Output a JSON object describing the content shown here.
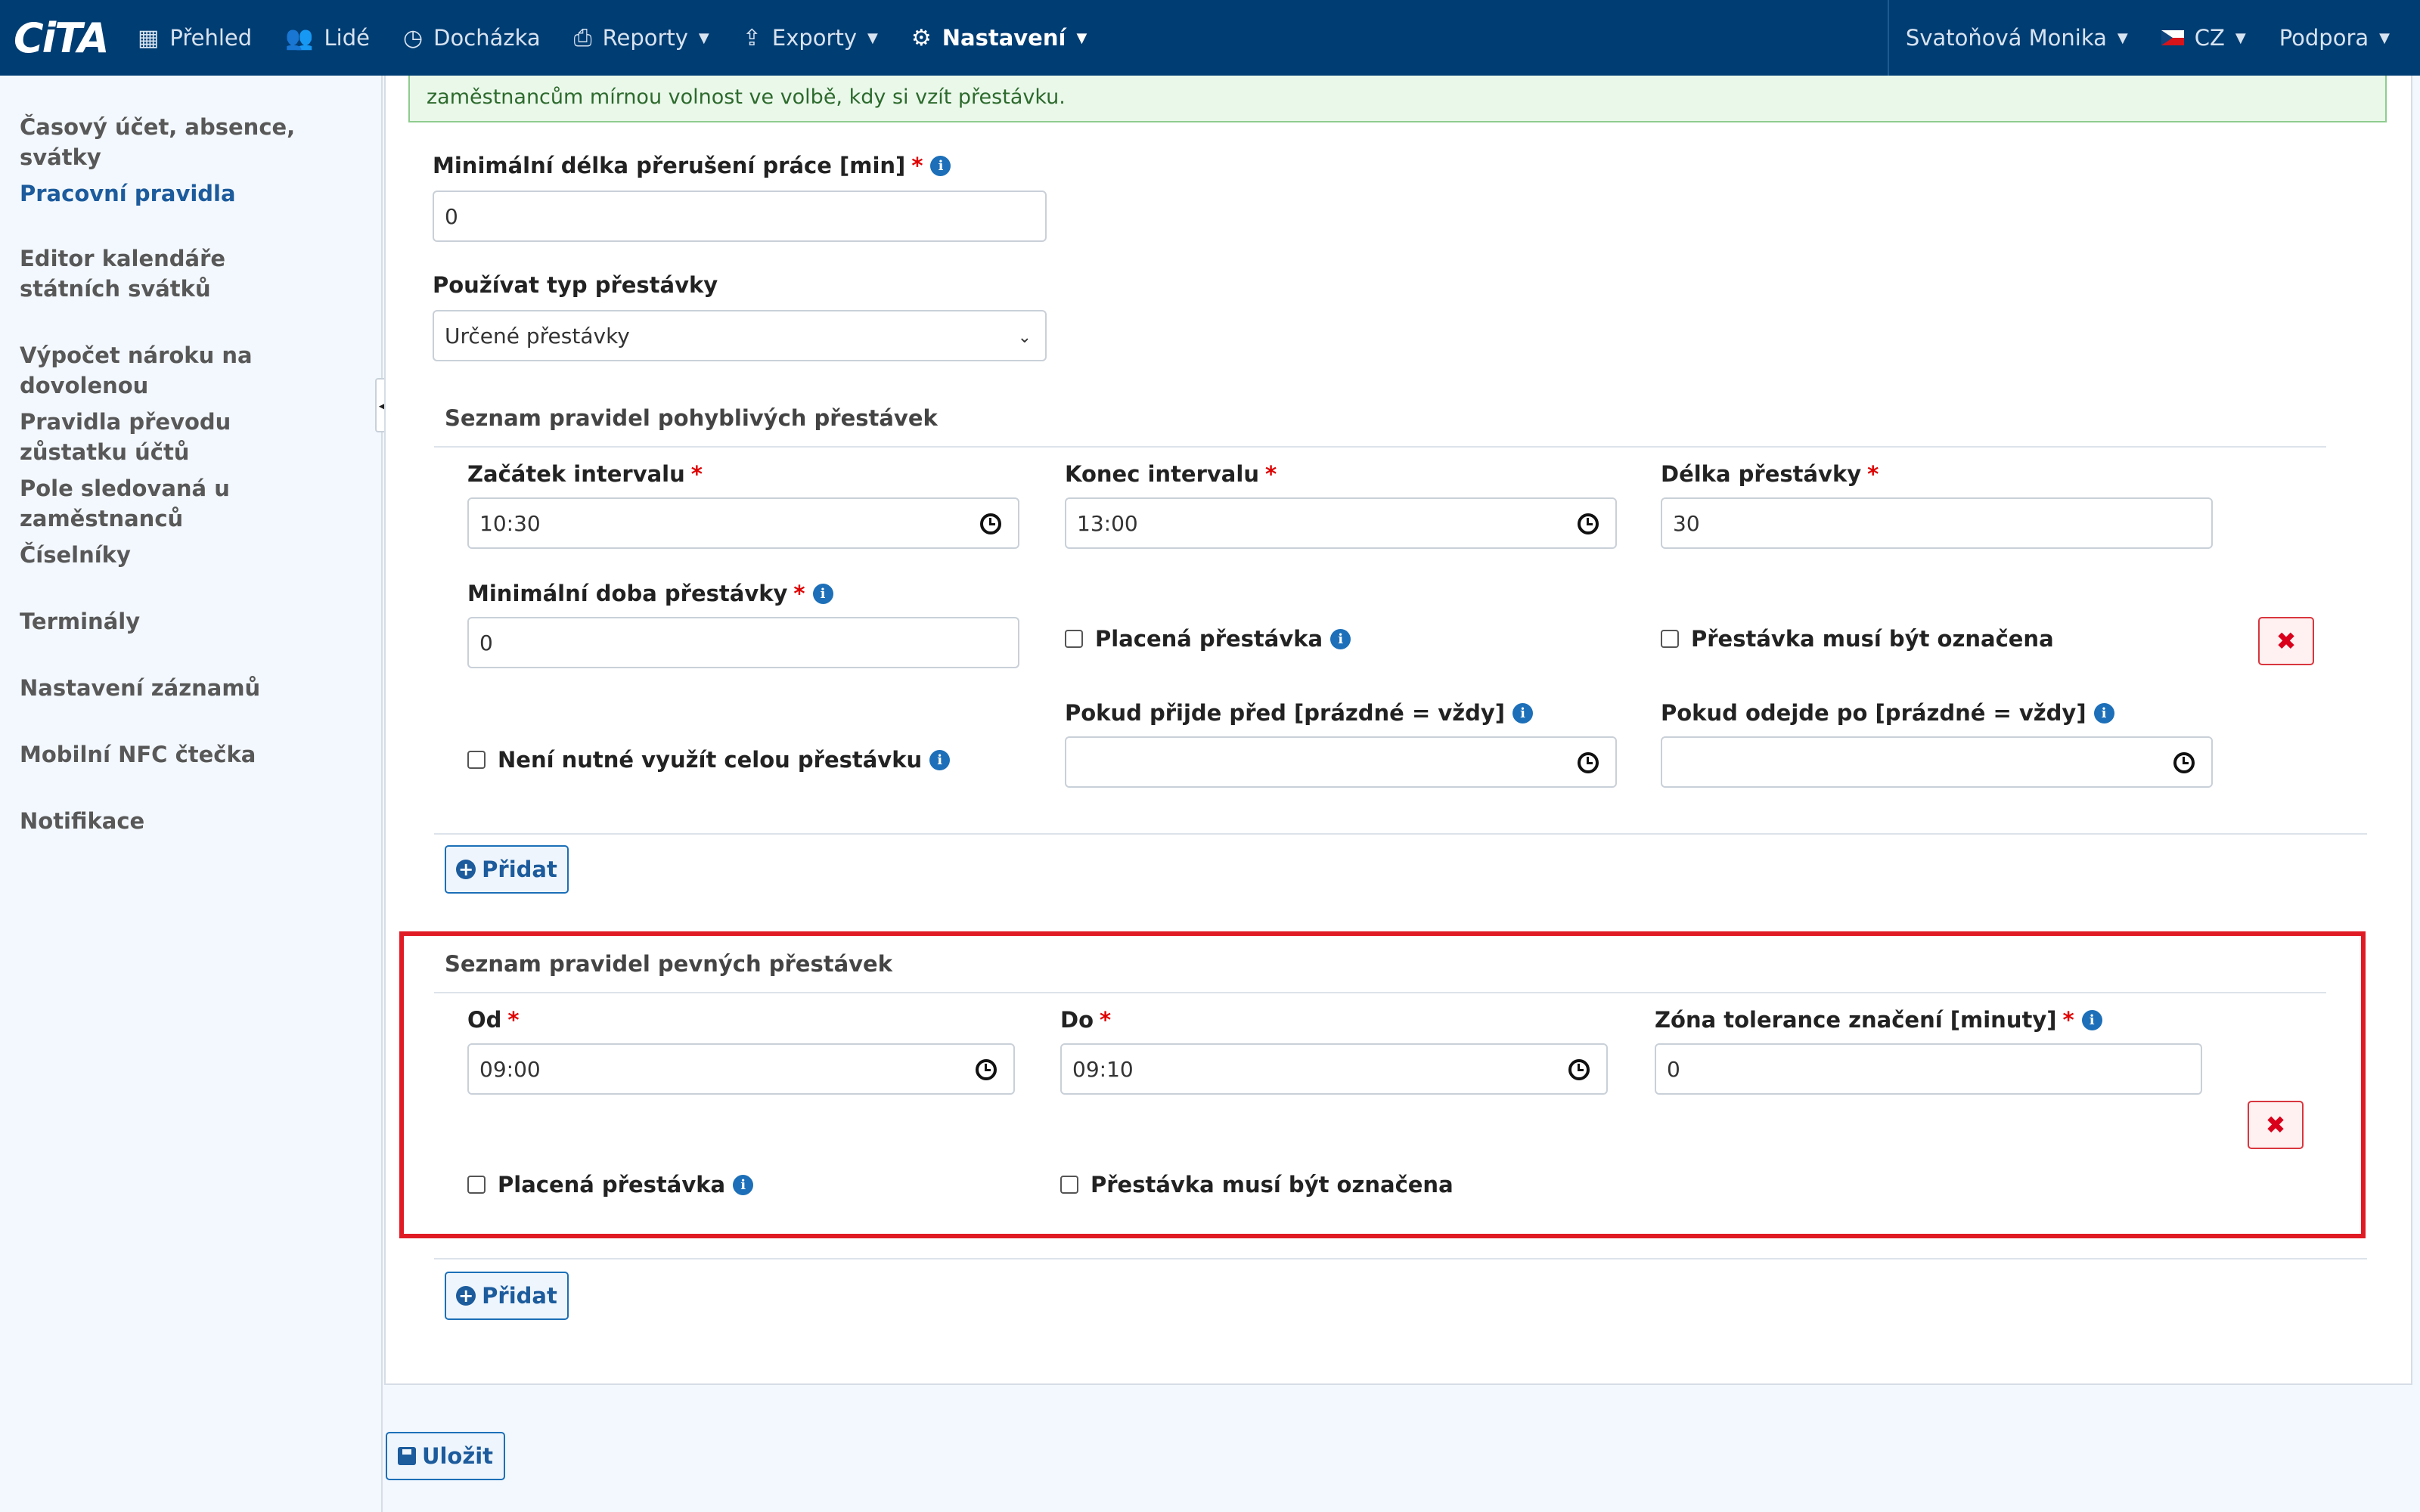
{
  "nav": {
    "logo": "CiTA",
    "items": [
      {
        "label": "Přehled",
        "icon": "grid-icon",
        "active": false,
        "caret": false
      },
      {
        "label": "Lidé",
        "icon": "users-icon",
        "active": false,
        "caret": false
      },
      {
        "label": "Docházka",
        "icon": "clock-icon",
        "active": false,
        "caret": false
      },
      {
        "label": "Reporty",
        "icon": "printer-icon",
        "active": false,
        "caret": true
      },
      {
        "label": "Exporty",
        "icon": "export-icon",
        "active": false,
        "caret": true
      },
      {
        "label": "Nastavení",
        "icon": "gear-icon",
        "active": true,
        "caret": true
      }
    ],
    "user": "Svatoňová Monika",
    "language": "CZ",
    "support": "Podpora"
  },
  "sidebar": {
    "items": [
      {
        "label": "Časový účet, absence, svátky",
        "active": false
      },
      {
        "label": "Pracovní pravidla",
        "active": true
      },
      {
        "label": "Editor kalendáře státních svátků",
        "active": false
      },
      {
        "label": "Výpočet nároku na dovolenou",
        "active": false
      },
      {
        "label": "Pravidla převodu zůstatku účtů",
        "active": false
      },
      {
        "label": "Pole sledovaná u zaměstnanců",
        "active": false
      },
      {
        "label": "Číselníky",
        "active": false
      },
      {
        "label": "Terminály",
        "active": false
      },
      {
        "label": "Nastavení záznamů",
        "active": false
      },
      {
        "label": "Mobilní NFC čtečka",
        "active": false
      },
      {
        "label": "Notifikace",
        "active": false
      }
    ]
  },
  "alert": {
    "text": "zaměstnancům mírnou volnost ve volbě, kdy si vzít přestávku."
  },
  "form": {
    "min_break_label": "Minimální délka přerušení práce [min]",
    "min_break_value": "0",
    "break_type_label": "Používat typ přestávky",
    "break_type_value": "Určené přestávky"
  },
  "flexible": {
    "title": "Seznam pravidel pohyblivých přestávek",
    "start_label": "Začátek intervalu",
    "start_value": "10:30",
    "end_label": "Konec intervalu",
    "end_value": "13:00",
    "length_label": "Délka přestávky",
    "length_value": "30",
    "min_label": "Minimální doba přestávky",
    "min_value": "0",
    "paid_label": "Placená přestávka",
    "marked_label": "Přestávka musí být označena",
    "arrive_label": "Pokud přijde před [prázdné = vždy]",
    "arrive_value": "",
    "leave_label": "Pokud odejde po [prázdné = vždy]",
    "leave_value": "",
    "not_full_label": "Není nutné využít celou přestávku",
    "delete_symbol": "✖",
    "add_label": "Přidat"
  },
  "fixed": {
    "title": "Seznam pravidel pevných přestávek",
    "from_label": "Od",
    "from_value": "09:00",
    "to_label": "Do",
    "to_value": "09:10",
    "tolerance_label": "Zóna tolerance značení [minuty]",
    "tolerance_value": "0",
    "paid_label": "Placená přestávka",
    "marked_label": "Přestávka musí být označena",
    "delete_symbol": "✖",
    "add_label": "Přidat"
  },
  "save_label": "Uložit",
  "colors": {
    "navbar": "#003d73",
    "accent": "#1c5b9c",
    "highlight": "#e01b24",
    "danger": "#d9001b"
  }
}
